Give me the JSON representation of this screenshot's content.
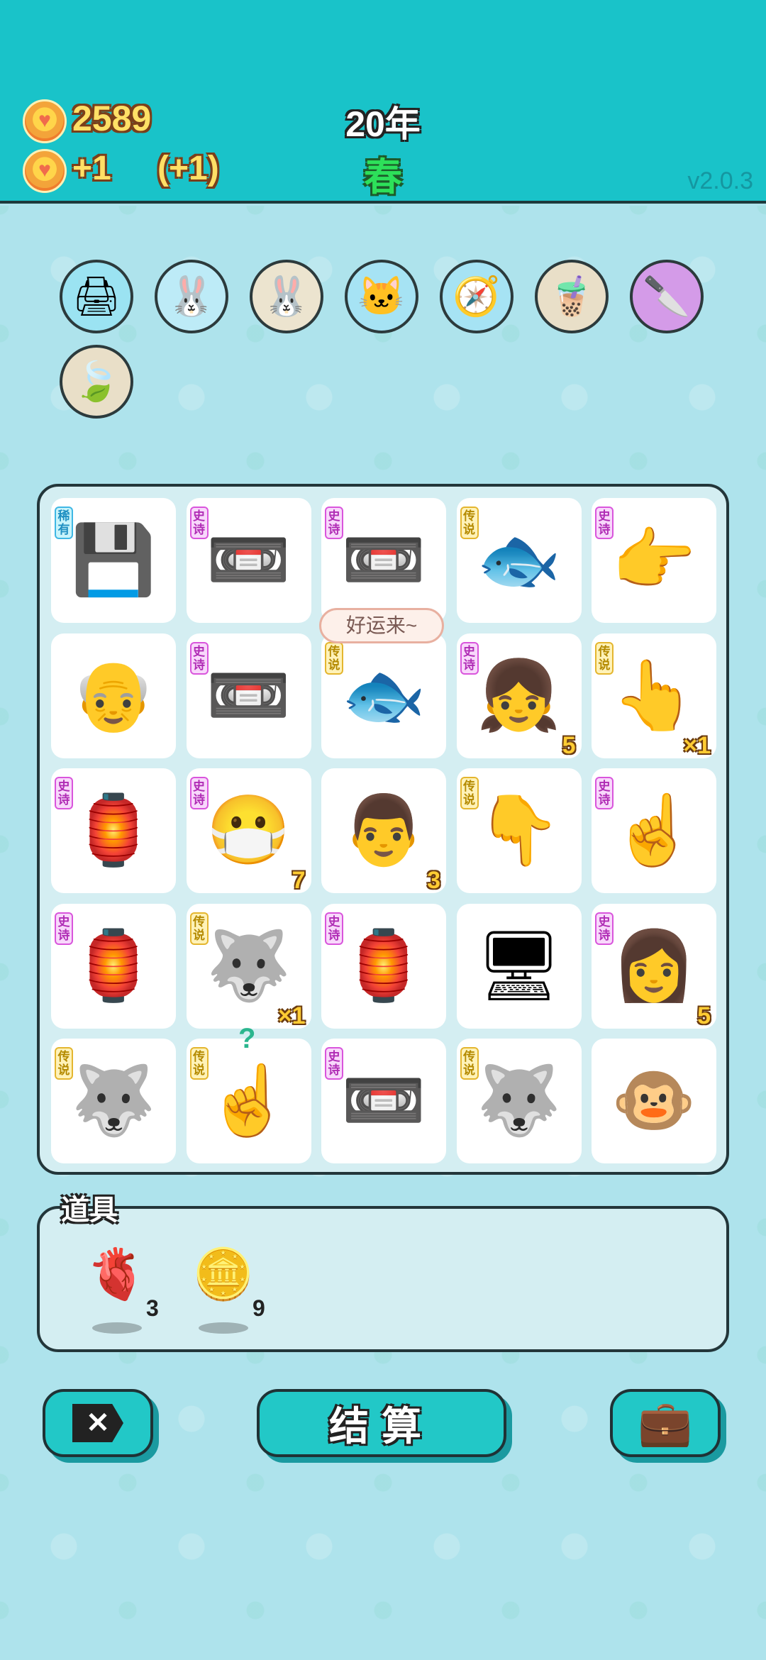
{
  "header": {
    "coins": "2589",
    "income": "+1",
    "income_bonus": "(+1)",
    "year": "20年",
    "season": "春",
    "version": "v2.0.3"
  },
  "relics": [
    {
      "name": "printer",
      "icon": "🖨",
      "bg": "#9be3f2"
    },
    {
      "name": "rabbit-white",
      "icon": "🐰",
      "bg": "#bdebf7"
    },
    {
      "name": "rabbit-beige",
      "icon": "🐰",
      "bg": "#ece4cf"
    },
    {
      "name": "cat",
      "icon": "🐱",
      "bg": "#a6e3f4"
    },
    {
      "name": "compass",
      "icon": "🧭",
      "bg": "#a6e3f4"
    },
    {
      "name": "bubble-tea",
      "icon": "🧋",
      "bg": "#e9dfc8"
    },
    {
      "name": "cleaver",
      "icon": "🔪",
      "bg": "#d49be8"
    },
    {
      "name": "leaf",
      "icon": "🍃",
      "bg": "#e9dfc8"
    }
  ],
  "board": {
    "rows": [
      [
        {
          "tag": "稀有",
          "icon": "💾",
          "count": ""
        },
        {
          "tag": "史诗",
          "icon": "📼",
          "count": ""
        },
        {
          "tag": "史诗",
          "icon": "📼",
          "count": ""
        },
        {
          "tag": "传说",
          "icon": "🐟",
          "count": ""
        },
        {
          "tag": "史诗",
          "icon": "👉",
          "count": ""
        }
      ],
      [
        {
          "tag": "",
          "icon": "👴",
          "count": ""
        },
        {
          "tag": "史诗",
          "icon": "📼",
          "count": ""
        },
        {
          "tag": "传说",
          "icon": "🐟",
          "count": ""
        },
        {
          "tag": "史诗",
          "icon": "👧",
          "count": "5"
        },
        {
          "tag": "传说",
          "icon": "👆",
          "count": "×1"
        }
      ],
      [
        {
          "tag": "史诗",
          "icon": "🏮",
          "count": ""
        },
        {
          "tag": "史诗",
          "icon": "😷",
          "count": "7"
        },
        {
          "tag": "",
          "icon": "👨",
          "count": "3"
        },
        {
          "tag": "传说",
          "icon": "👇",
          "count": ""
        },
        {
          "tag": "史诗",
          "icon": "☝",
          "count": ""
        }
      ],
      [
        {
          "tag": "史诗",
          "icon": "🏮",
          "count": ""
        },
        {
          "tag": "传说",
          "icon": "🐺",
          "count": "×1"
        },
        {
          "tag": "史诗",
          "icon": "🏮",
          "count": ""
        },
        {
          "tag": "",
          "icon": "🖥",
          "count": ""
        },
        {
          "tag": "史诗",
          "icon": "👩",
          "count": "5"
        }
      ],
      [
        {
          "tag": "传说",
          "icon": "🐺",
          "count": ""
        },
        {
          "tag": "传说",
          "icon": "☝",
          "count": ""
        },
        {
          "tag": "史诗",
          "icon": "📼",
          "count": ""
        },
        {
          "tag": "传说",
          "icon": "🐺",
          "count": ""
        },
        {
          "tag": "",
          "icon": "🐵",
          "count": ""
        }
      ]
    ],
    "speech_bubble": "好运来~",
    "question_mark": "?"
  },
  "props": {
    "title": "道具",
    "items": [
      {
        "name": "liver",
        "icon": "🫀",
        "count": "3"
      },
      {
        "name": "dollar-coin",
        "icon": "🪙",
        "count": "9"
      }
    ]
  },
  "buttons": {
    "exit_icon": "✕",
    "settle_label": "结算",
    "bag_icon": "💼"
  },
  "colors": {
    "header_bg": "#19c3c9",
    "page_bg": "#aee3ec",
    "button_bg": "#22c8c7",
    "season_green": "#2de05a",
    "coin_yellow": "#ffe066"
  }
}
